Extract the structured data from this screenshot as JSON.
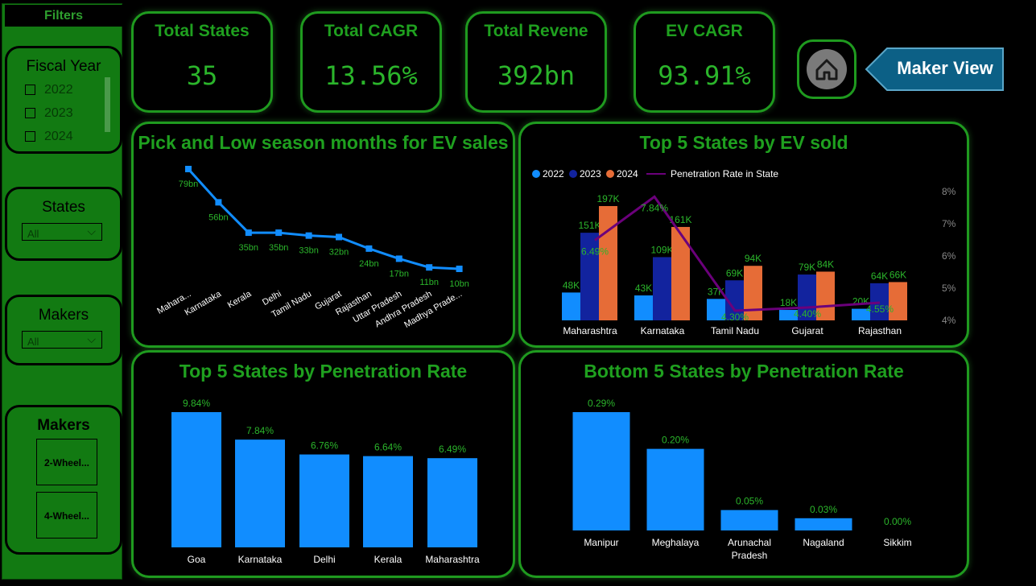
{
  "sidebar": {
    "header": "Filters",
    "fiscal_year": {
      "title": "Fiscal Year",
      "options": [
        "2022",
        "2023",
        "2024"
      ]
    },
    "states": {
      "title": "States",
      "selected": "All"
    },
    "makers_dropdown": {
      "title": "Makers",
      "selected": "All"
    },
    "makers_tiles": {
      "title": "Makers",
      "tiles": [
        "2-Wheel...",
        "4-Wheel..."
      ]
    }
  },
  "kpis": [
    {
      "title": "Total States",
      "value": "35"
    },
    {
      "title": "Total CAGR",
      "value": "13.56%"
    },
    {
      "title": "Total Revene",
      "value": "392bn"
    },
    {
      "title": "EV CAGR",
      "value": "93.91%"
    }
  ],
  "nav": {
    "home_icon": "home-icon",
    "maker_view_label": "Maker View"
  },
  "colors": {
    "accent_green": "#1fa01f",
    "bar_blue": "#118dff",
    "navy": "#12239e",
    "orange": "#e66c37",
    "purple": "#6b007b"
  },
  "chart_data": [
    {
      "type": "line",
      "title": "Pick and Low season months for EV sales",
      "categories": [
        "Mahara...",
        "Karnataka",
        "Kerala",
        "Delhi",
        "Tamil Nadu",
        "Gujarat",
        "Rajasthan",
        "Uttar Pradesh",
        "Andhra Pradesh",
        "Madhya Prade..."
      ],
      "values": [
        79,
        56,
        35,
        35,
        33,
        32,
        24,
        17,
        11,
        10
      ],
      "labels": [
        "79bn",
        "56bn",
        "35bn",
        "35bn",
        "33bn",
        "32bn",
        "24bn",
        "17bn",
        "11bn",
        "10bn"
      ],
      "color": "#118dff"
    },
    {
      "type": "bar",
      "title": "Top 5 States by EV sold",
      "categories": [
        "Maharashtra",
        "Karnataka",
        "Tamil Nadu",
        "Gujarat",
        "Rajasthan"
      ],
      "legend": [
        "2022",
        "2023",
        "2024",
        "Penetration Rate in State"
      ],
      "series": [
        {
          "name": "2022",
          "color": "#118dff",
          "values": [
            48,
            43,
            37,
            18,
            20
          ],
          "labels": [
            "48K",
            "43K",
            "37K",
            "18K",
            "20K"
          ]
        },
        {
          "name": "2023",
          "color": "#12239e",
          "values": [
            151,
            109,
            69,
            79,
            64
          ],
          "labels": [
            "151K",
            "109K",
            "69K",
            "79K",
            "64K"
          ]
        },
        {
          "name": "2024",
          "color": "#e66c37",
          "values": [
            197,
            161,
            94,
            84,
            66
          ],
          "labels": [
            "197K",
            "161K",
            "94K",
            "84K",
            "66K"
          ]
        }
      ],
      "line_series": {
        "name": "Penetration Rate in State",
        "color": "#6b007b",
        "values": [
          6.49,
          7.84,
          4.3,
          4.4,
          4.55
        ],
        "labels": [
          "6.49%",
          "7.84%",
          "4.30%",
          "4.40%",
          "4.55%"
        ]
      },
      "y2_ticks": [
        "8%",
        "7%",
        "6%",
        "5%",
        "4%"
      ],
      "y2_range": [
        4,
        8
      ]
    },
    {
      "type": "bar",
      "title": "Top 5 States by Penetration Rate",
      "categories": [
        "Goa",
        "Karnataka",
        "Delhi",
        "Kerala",
        "Maharashtra"
      ],
      "values": [
        9.84,
        7.84,
        6.76,
        6.64,
        6.49
      ],
      "labels": [
        "9.84%",
        "7.84%",
        "6.76%",
        "6.64%",
        "6.49%"
      ],
      "color": "#118dff"
    },
    {
      "type": "bar",
      "title": "Bottom 5 States by Penetration Rate",
      "categories": [
        "Manipur",
        "Meghalaya",
        "Arunachal Pradesh",
        "Nagaland",
        "Sikkim"
      ],
      "values": [
        0.29,
        0.2,
        0.05,
        0.03,
        0.0
      ],
      "labels": [
        "0.29%",
        "0.20%",
        "0.05%",
        "0.03%",
        "0.00%"
      ],
      "color": "#118dff"
    }
  ]
}
